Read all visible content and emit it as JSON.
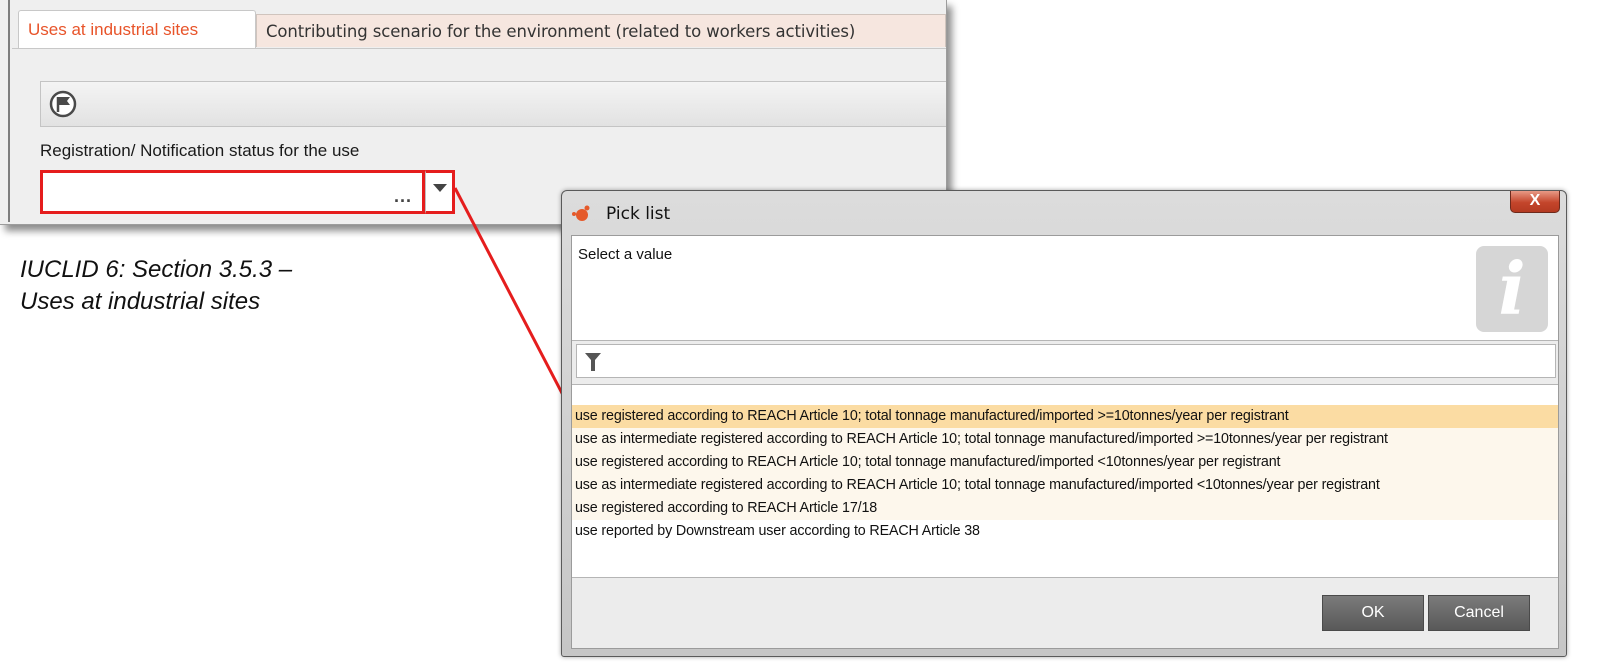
{
  "panel": {
    "tabs": [
      {
        "label": "Uses at industrial sites",
        "active": true
      },
      {
        "label": "Contributing scenario for the environment (related to workers activities)",
        "active": false
      }
    ],
    "field_label": "Registration/ Notification status for the use",
    "field_value": "",
    "ellipsis": "...",
    "flag_icon": "flag-icon"
  },
  "caption": {
    "line1": "IUCLID 6: Section 3.5.3 –",
    "line2": "Uses at industrial sites"
  },
  "dialog": {
    "title": "Pick list",
    "close_glyph": "X",
    "prompt": "Select a value",
    "info_glyph": "i",
    "filter_value": "",
    "items": [
      {
        "label": "use registered according to REACH Article 10; total tonnage manufactured/imported >=10tonnes/year per registrant",
        "selected": true
      },
      {
        "label": "use as intermediate registered according to REACH Article 10; total tonnage manufactured/imported >=10tonnes/year per registrant",
        "selected": false
      },
      {
        "label": "use registered according to REACH Article 10; total tonnage manufactured/imported <10tonnes/year per registrant",
        "selected": false
      },
      {
        "label": "use as intermediate registered according to REACH Article 10; total tonnage manufactured/imported <10tonnes/year per registrant",
        "selected": false
      },
      {
        "label": "use registered according to REACH Article 17/18",
        "selected": false
      },
      {
        "label": "use reported by Downstream user according to REACH Article 38",
        "selected": false
      }
    ],
    "ok_label": "OK",
    "cancel_label": "Cancel"
  },
  "colors": {
    "highlight_red": "#e51d1d",
    "active_tab_text": "#e8542a",
    "selected_row": "#fbdca3"
  }
}
